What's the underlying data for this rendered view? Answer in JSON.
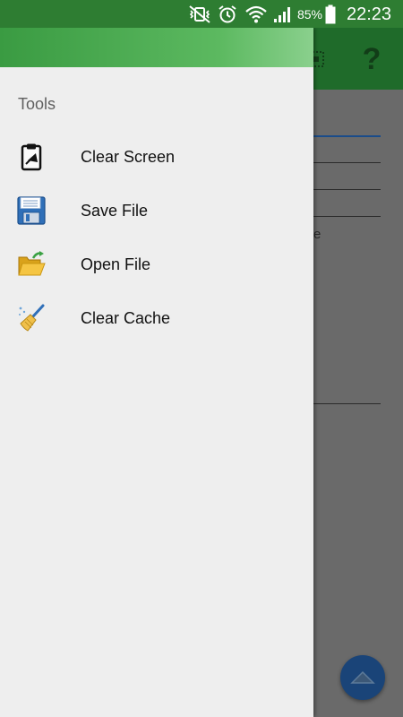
{
  "status_bar": {
    "battery_percent": "85%",
    "time": "22:23",
    "icons": [
      "vibrate-mute-icon",
      "alarm-icon",
      "wifi-icon",
      "signal-icon",
      "battery-icon"
    ]
  },
  "app": {
    "toolbar_icons": [
      "grid-icon",
      "help-icon"
    ],
    "help_glyph": "?",
    "fragment_text": "e"
  },
  "drawer": {
    "section_title": "Tools",
    "items": [
      {
        "label": "Clear Screen",
        "icon": "clipboard-clear-icon"
      },
      {
        "label": "Save File",
        "icon": "floppy-disk-icon"
      },
      {
        "label": "Open File",
        "icon": "folder-open-icon"
      },
      {
        "label": "Clear Cache",
        "icon": "broom-icon"
      }
    ]
  },
  "colors": {
    "status_bar": "#2e7d32",
    "toolbar": "#1f6b2a",
    "drawer_bg": "#eeeeee",
    "drawer_header_start": "#3a9b42",
    "scrim": "#6a6a6a",
    "fab": "#1a4478"
  }
}
